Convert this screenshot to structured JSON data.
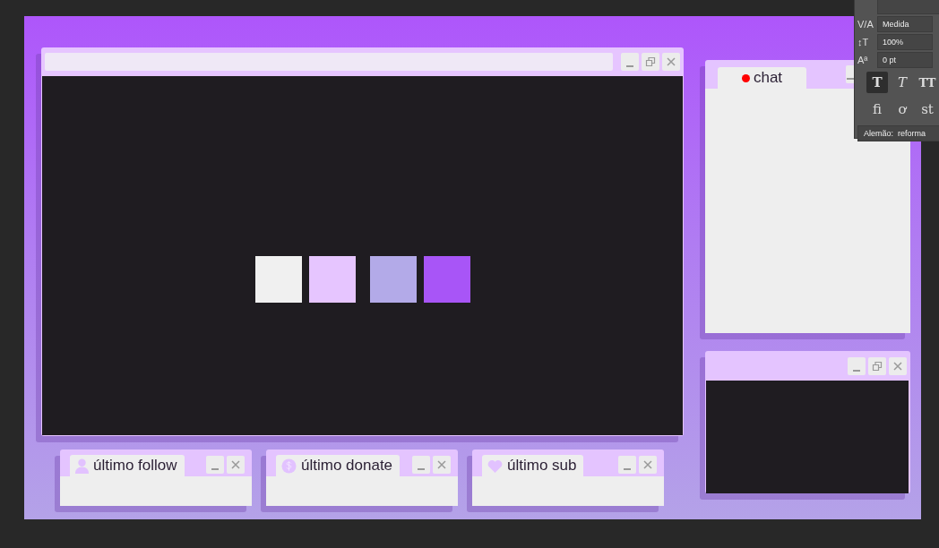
{
  "main_window": {
    "buttons": [
      {
        "kind": "minimize"
      },
      {
        "kind": "restore"
      },
      {
        "kind": "close"
      }
    ],
    "swatches": [
      {
        "color": "#f0f0f0"
      },
      {
        "color": "#e6c5ff"
      },
      {
        "color": "#b3aae8"
      },
      {
        "color": "#a855f7"
      }
    ]
  },
  "chat": {
    "tab": "chat",
    "live": true,
    "buttons": [
      {
        "kind": "minimize"
      }
    ]
  },
  "camera": {
    "buttons": [
      {
        "kind": "minimize"
      },
      {
        "kind": "restore"
      },
      {
        "kind": "close"
      }
    ]
  },
  "widgets": [
    {
      "label": "último follow",
      "kind": "follow",
      "buttons": [
        {
          "kind": "minimize"
        },
        {
          "kind": "close"
        }
      ]
    },
    {
      "label": "último donate",
      "kind": "donate",
      "buttons": [
        {
          "kind": "minimize"
        },
        {
          "kind": "close"
        }
      ]
    },
    {
      "label": "último sub",
      "kind": "sub",
      "buttons": [
        {
          "kind": "minimize"
        },
        {
          "kind": "close"
        }
      ]
    }
  ],
  "character_panel": {
    "fields": [
      {
        "icon": "V/A",
        "value": "Medida"
      },
      {
        "icon": "↕T",
        "value": "100%"
      },
      {
        "icon": "Aª",
        "value": "0 pt"
      }
    ],
    "styles": [
      {
        "label": "T",
        "kind": "bold",
        "selected": true
      },
      {
        "label": "T",
        "kind": "italic",
        "selected": false
      },
      {
        "label": "TT",
        "kind": "caps",
        "selected": false
      }
    ],
    "ligatures": [
      "fi",
      "ơ",
      "st"
    ],
    "language": "Alemão:",
    "hyphenation": "reforma"
  }
}
